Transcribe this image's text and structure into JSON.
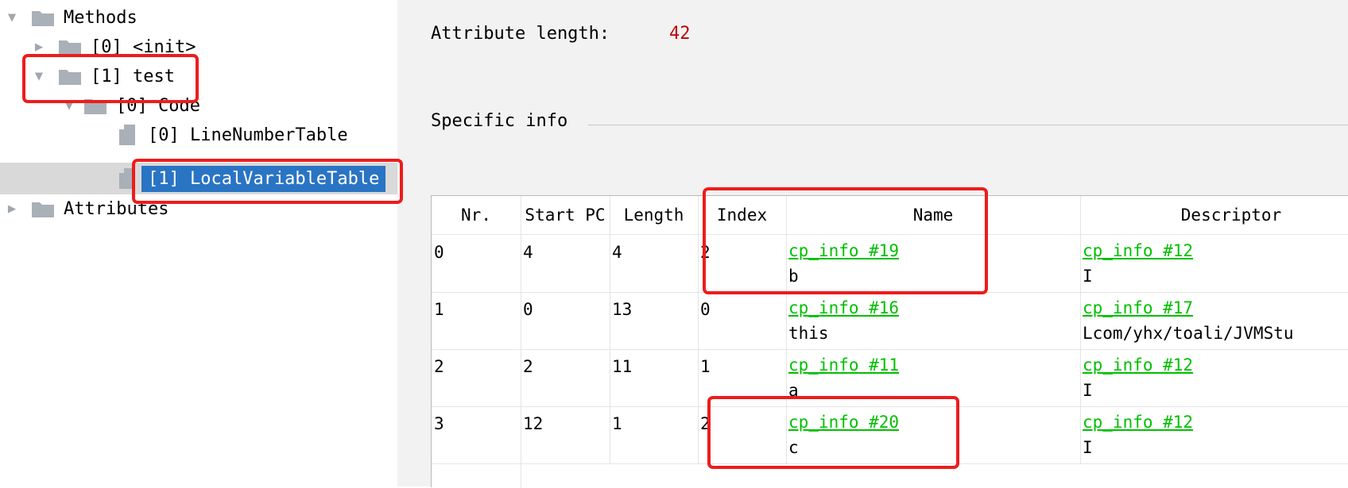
{
  "tree": {
    "methods_label": "Methods",
    "init_label": "[0] <init>",
    "test_label": "[1] test",
    "code_label": "[0] Code",
    "line_number_table_label": "[0] LineNumberTable",
    "local_variable_table_label": "[1] LocalVariableTable",
    "attributes_label": "Attributes"
  },
  "details": {
    "attribute_length_label": "Attribute length:",
    "attribute_length_value": "42",
    "specific_info_label": "Specific info"
  },
  "table": {
    "headers": [
      "Nr.",
      "Start PC",
      "Length",
      "Index",
      "Name",
      "Descriptor"
    ],
    "rows": [
      {
        "nr": "0",
        "start_pc": "4",
        "length": "4",
        "index": "2",
        "name_link": "cp_info #19",
        "name_value": "b",
        "descriptor_link": "cp_info #12",
        "descriptor_value": "I"
      },
      {
        "nr": "1",
        "start_pc": "0",
        "length": "13",
        "index": "0",
        "name_link": "cp_info #16",
        "name_value": "this",
        "descriptor_link": "cp_info #17",
        "descriptor_value": "Lcom/yhx/toali/JVMStu"
      },
      {
        "nr": "2",
        "start_pc": "2",
        "length": "11",
        "index": "1",
        "name_link": "cp_info #11",
        "name_value": "a",
        "descriptor_link": "cp_info #12",
        "descriptor_value": "I"
      },
      {
        "nr": "3",
        "start_pc": "12",
        "length": "1",
        "index": "2",
        "name_link": "cp_info #20",
        "name_value": "c",
        "descriptor_link": "cp_info #12",
        "descriptor_value": "I"
      }
    ]
  },
  "colors": {
    "selection": "#2a74c4",
    "link": "#00c000",
    "value_red": "#c00000",
    "annotation": "#ee1c1c"
  }
}
